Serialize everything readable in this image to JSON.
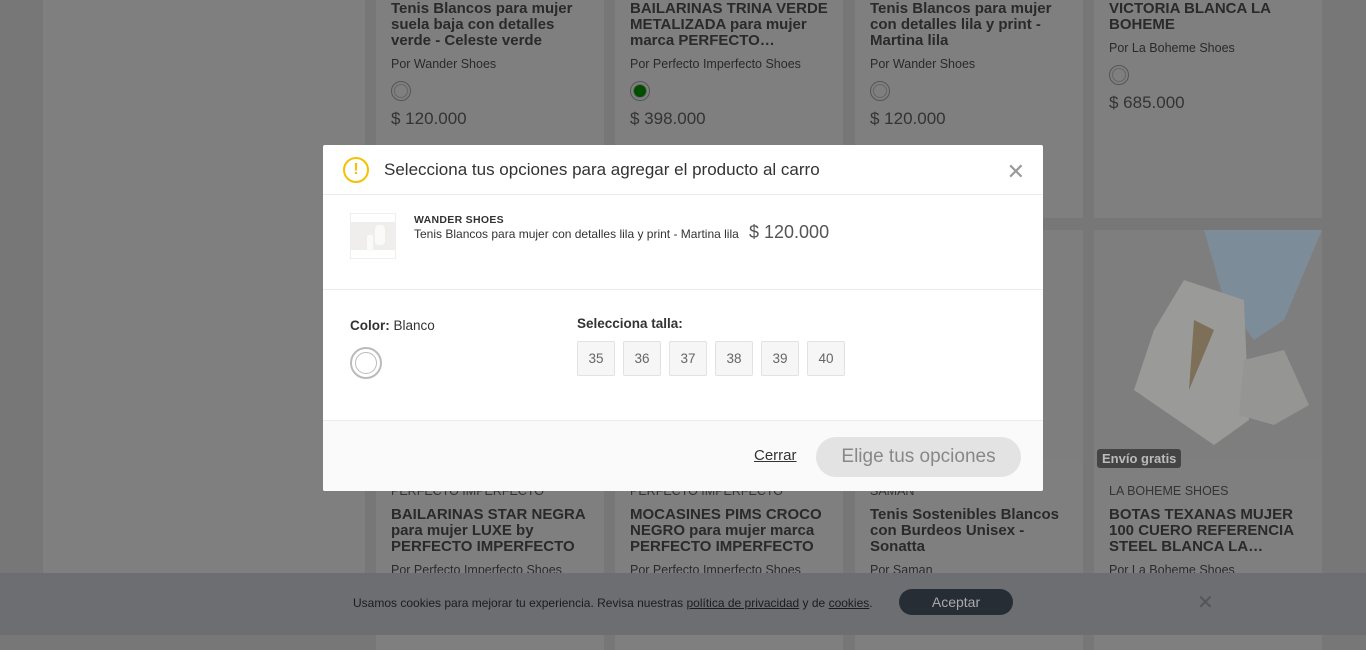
{
  "top_cards": [
    {
      "title": "Tenis Blancos para mujer suela baja con detalles verde - Celeste verde",
      "by": "Por Wander Shoes",
      "swatch": "#7f7f7f",
      "price": "$ 120.000"
    },
    {
      "title": "BAILARINAS TRINA VERDE METALIZADA para mujer marca PERFECTO…",
      "by": "Por Perfecto Imperfecto Shoes",
      "swatch": "#004d00",
      "price": "$ 398.000"
    },
    {
      "title": "Tenis Blancos para mujer con detalles lila y print - Martina lila",
      "by": "Por Wander Shoes",
      "swatch": "#7f7f7f",
      "price": "$ 120.000"
    },
    {
      "title": "VICTORIA BLANCA LA BOHEME",
      "by": "Por La Boheme Shoes",
      "swatch": "#7f7f7f",
      "price": "$ 685.000"
    }
  ],
  "bottom_cards": [
    {
      "brand": "PERFECTO IMPERFECTO",
      "title": "BAILARINAS STAR NEGRA para mujer LUXE by PERFECTO IMPERFECTO",
      "by": "Por Perfecto Imperfecto Shoes"
    },
    {
      "brand": "PERFECTO IMPERFECTO",
      "title": "MOCASINES PIMS CROCO NEGRO para mujer marca PERFECTO IMPERFECTO",
      "by": "Por Perfecto Imperfecto Shoes"
    },
    {
      "brand": "SAMAN",
      "title": "Tenis Sostenibles Blancos con Burdeos Unisex - Sonatta",
      "by": "Por Saman"
    },
    {
      "brand": "LA BOHEME SHOES",
      "title": "BOTAS TEXANAS MUJER 100 CUERO REFERENCIA STEEL BLANCA LA…",
      "by": "Por La Boheme Shoes",
      "badge": "Envío gratis"
    }
  ],
  "modal": {
    "icon": "warning-icon",
    "title": "Selecciona tus opciones para agregar el producto al carro",
    "product": {
      "brand": "WANDER SHOES",
      "name": "Tenis Blancos para mujer con detalles lila y print - Martina lila",
      "price": "$ 120.000"
    },
    "color_label": "Color:",
    "color_value": "Blanco",
    "size_label": "Selecciona talla:",
    "sizes": [
      "35",
      "36",
      "37",
      "38",
      "39",
      "40"
    ],
    "close_label": "Cerrar",
    "submit_label": "Elige tus opciones",
    "accent": "#f2c200"
  },
  "cookie": {
    "text1": "Usamos cookies para mejorar tu experiencia. Revisa nuestras ",
    "link1": "política de privacidad",
    "text2": " y de ",
    "link2": "cookies",
    "text3": ".",
    "accept": "Aceptar"
  }
}
